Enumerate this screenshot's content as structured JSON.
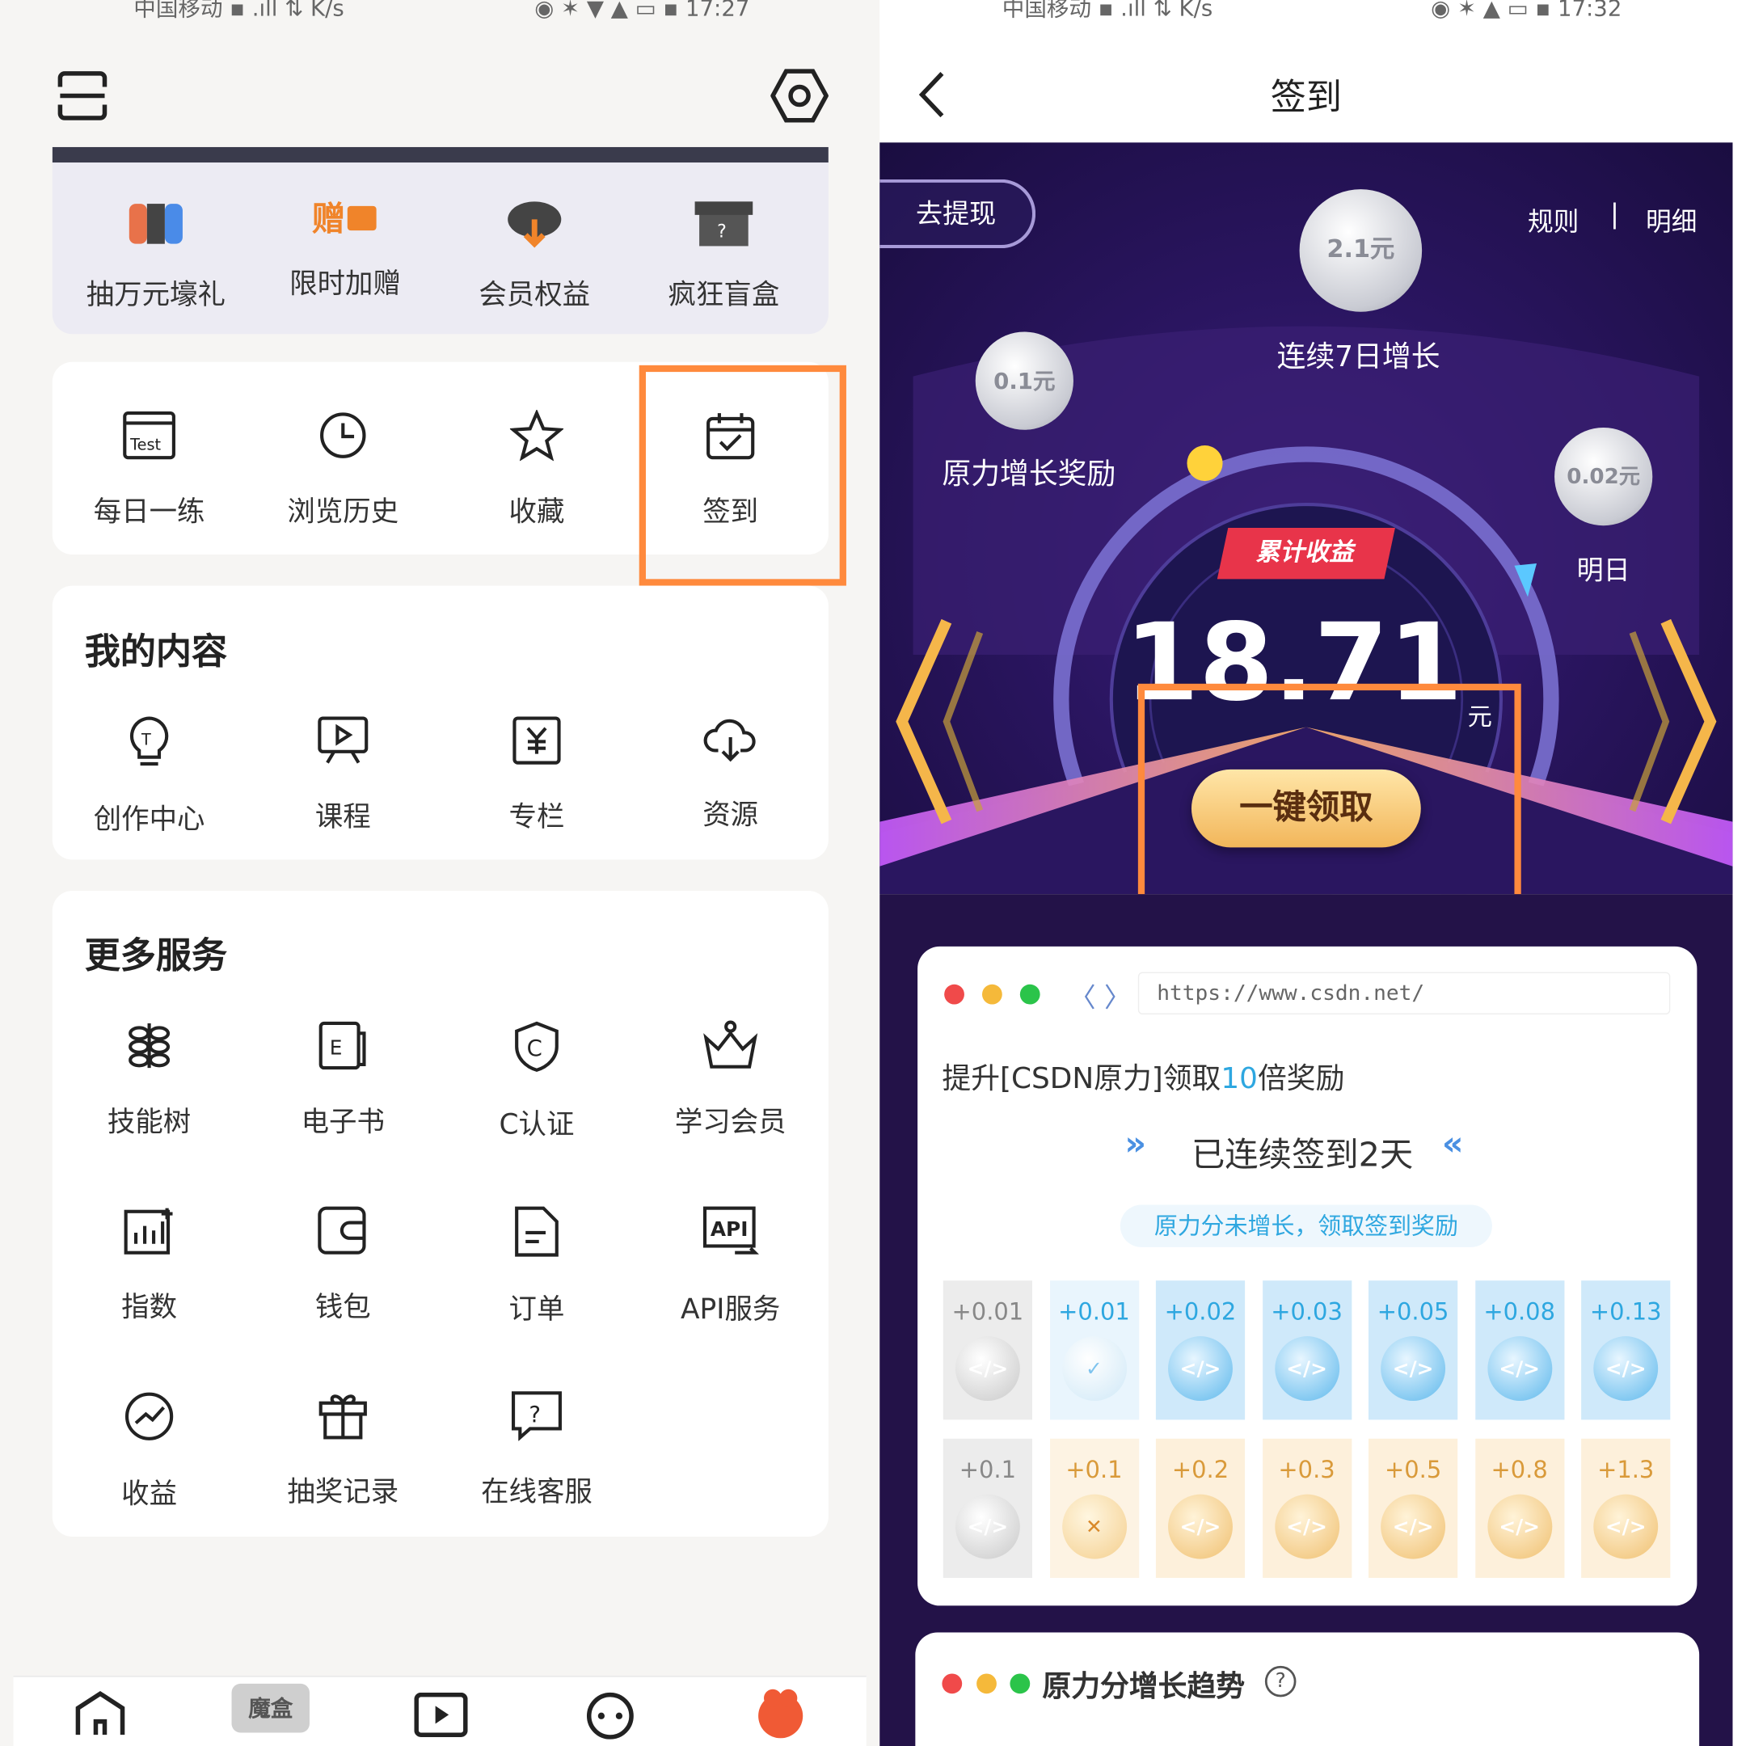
{
  "left": {
    "status": {
      "carrier": "中国移动",
      "speed": "K/s",
      "time": "17:27"
    },
    "promo_items": [
      {
        "label": "抽万元壕礼",
        "icon": "switch-console-icon"
      },
      {
        "label": "限时加赠",
        "icon": "gift-text-icon"
      },
      {
        "label": "会员权益",
        "icon": "cloud-download-icon"
      },
      {
        "label": "疯狂盲盒",
        "icon": "mystery-box-icon"
      }
    ],
    "quick_items": [
      {
        "label": "每日一练",
        "icon": "test-icon"
      },
      {
        "label": "浏览历史",
        "icon": "clock-icon"
      },
      {
        "label": "收藏",
        "icon": "star-icon"
      },
      {
        "label": "签到",
        "icon": "calendar-check-icon"
      }
    ],
    "my_content": {
      "title": "我的内容",
      "items": [
        {
          "label": "创作中心",
          "icon": "lightbulb-icon"
        },
        {
          "label": "课程",
          "icon": "presentation-icon"
        },
        {
          "label": "专栏",
          "icon": "yen-book-icon"
        },
        {
          "label": "资源",
          "icon": "cloud-download-icon"
        }
      ]
    },
    "more_services": {
      "title": "更多服务",
      "items": [
        {
          "label": "技能树",
          "icon": "skill-tree-icon"
        },
        {
          "label": "电子书",
          "icon": "ebook-icon"
        },
        {
          "label": "C认证",
          "icon": "shield-c-icon"
        },
        {
          "label": "学习会员",
          "icon": "crown-icon"
        },
        {
          "label": "指数",
          "icon": "chart-icon"
        },
        {
          "label": "钱包",
          "icon": "wallet-icon"
        },
        {
          "label": "订单",
          "icon": "document-icon"
        },
        {
          "label": "API服务",
          "icon": "api-icon"
        },
        {
          "label": "收益",
          "icon": "income-icon"
        },
        {
          "label": "抽奖记录",
          "icon": "gift-box-icon"
        },
        {
          "label": "在线客服",
          "icon": "help-chat-icon"
        }
      ]
    },
    "bottom_nav": [
      {
        "icon": "home-icon"
      },
      {
        "icon": "blindbox-icon",
        "label": "魔盒"
      },
      {
        "icon": "play-icon"
      },
      {
        "icon": "chat-icon"
      },
      {
        "icon": "profile-icon"
      }
    ]
  },
  "right": {
    "status": {
      "carrier": "中国移动",
      "speed": "K/s",
      "time": "17:32"
    },
    "nav_title": "签到",
    "withdraw_label": "去提现",
    "rules_label": "规则",
    "details_label": "明细",
    "separator": "|",
    "coin_top": "2.1元",
    "coin_top_label": "连续7日增长",
    "coin_left": "0.1元",
    "coin_left_label": "原力增长奖励",
    "coin_right": "0.02元",
    "coin_right_label": "明日",
    "accum_label": "累计收益",
    "amount": "18.71",
    "amount_unit": "元",
    "claim_button": "一键领取",
    "url": "https://www.csdn.net/",
    "promo_prefix": "提升[CSDN原力]领取",
    "promo_number": "10",
    "promo_suffix": "倍奖励",
    "streak": "已连续签到2天",
    "streak_note": "原力分未增长，领取签到奖励",
    "row1": [
      "+0.01",
      "+0.01",
      "+0.02",
      "+0.03",
      "+0.05",
      "+0.08",
      "+0.13"
    ],
    "row2": [
      "+0.1",
      "+0.1",
      "+0.2",
      "+0.3",
      "+0.5",
      "+0.8",
      "+1.3"
    ],
    "coin_glyph": "</>",
    "check_glyph": "✓",
    "cross_glyph": "✕",
    "trend_title": "原力分增长趋势",
    "trend_help": "?",
    "colors": {
      "accent_orange": "#ff8a3d",
      "banner_purple": "#2a1560",
      "badge_red": "#e8344a",
      "blue_link": "#2ea7e0",
      "gold": "#f2c46a"
    }
  }
}
